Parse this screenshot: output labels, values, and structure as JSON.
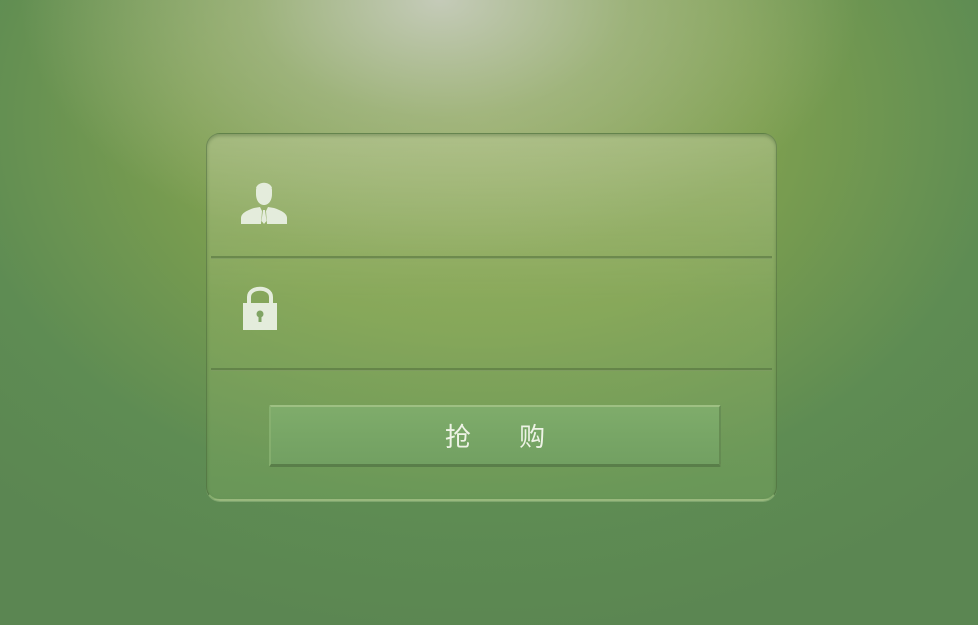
{
  "login_form": {
    "username": {
      "icon": "user-icon",
      "value": "",
      "placeholder": ""
    },
    "password": {
      "icon": "lock-icon",
      "value": "",
      "placeholder": ""
    },
    "submit_label": "抢 购"
  },
  "colors": {
    "background": "#5f8a55",
    "highlight": "#b8c4a8",
    "panel": "#9ab578",
    "button": "#78a666",
    "icon": "#e4ecdc"
  }
}
